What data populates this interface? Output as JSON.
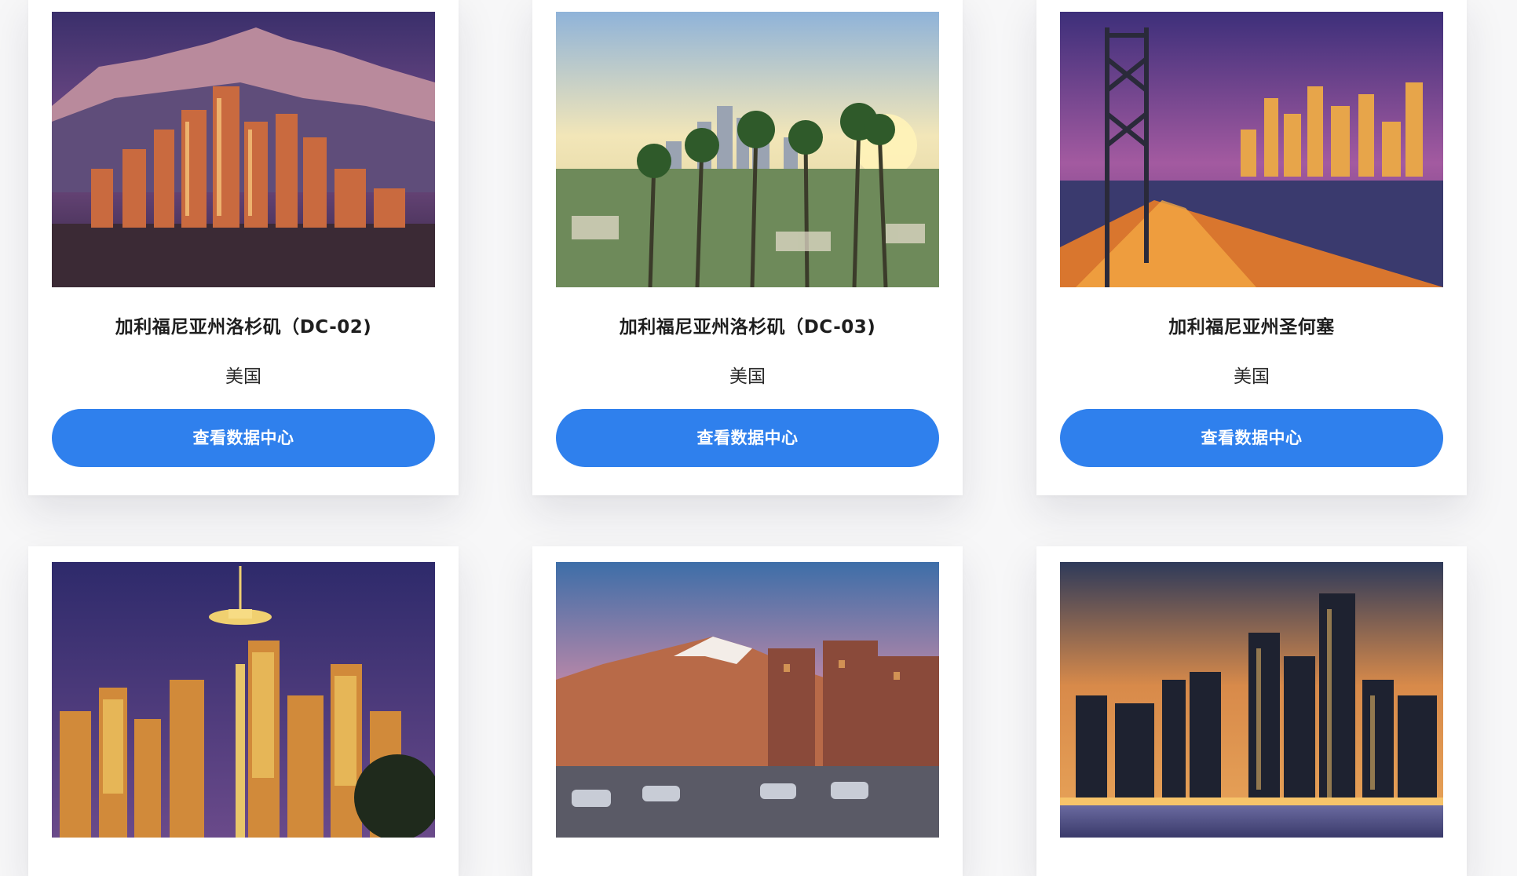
{
  "cards": [
    {
      "title": "加利福尼亚州洛杉矶（DC-02)",
      "country": "美国",
      "button": "查看数据中心",
      "image": "los-angeles-skyline-mountains-photo"
    },
    {
      "title": "加利福尼亚州洛杉矶（DC-03)",
      "country": "美国",
      "button": "查看数据中心",
      "image": "los-angeles-palm-trees-photo"
    },
    {
      "title": "加利福尼亚州圣何塞",
      "country": "美国",
      "button": "查看数据中心",
      "image": "bay-bridge-night-photo"
    },
    {
      "title": "",
      "country": "",
      "button": "",
      "image": "seattle-space-needle-photo"
    },
    {
      "title": "",
      "country": "",
      "button": "",
      "image": "mountain-town-street-photo"
    },
    {
      "title": "",
      "country": "",
      "button": "",
      "image": "chicago-skyline-sunset-photo"
    }
  ],
  "colors": {
    "button": "#2f80ed",
    "background": "#f7f7f8",
    "card": "#ffffff"
  }
}
